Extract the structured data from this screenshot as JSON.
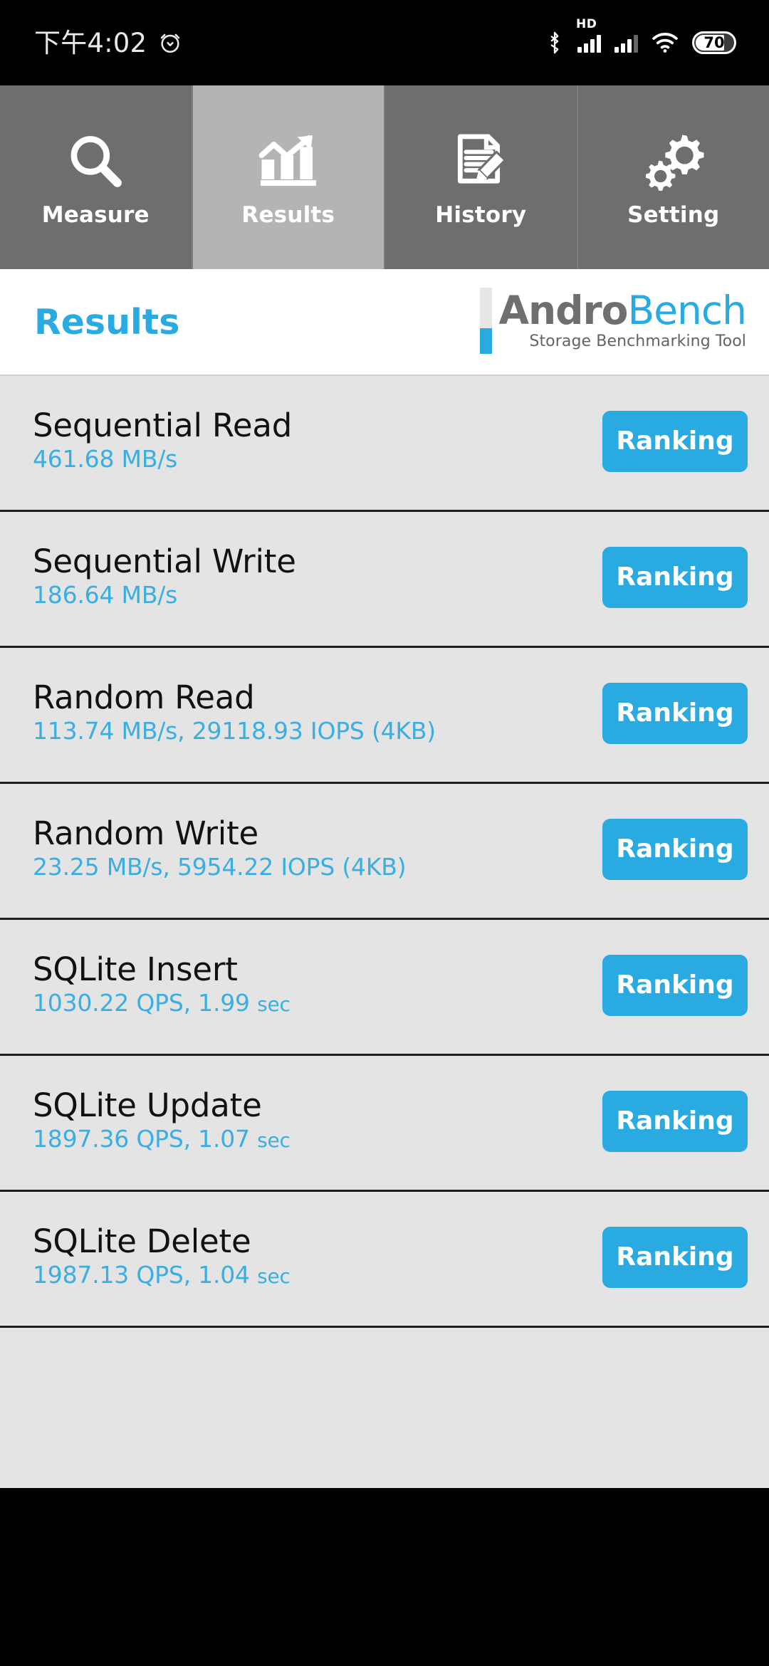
{
  "status_bar": {
    "clock": "下午4:02",
    "alarm_icon": "alarm-clock-icon",
    "bluetooth_icon": "bluetooth-icon",
    "hd_label": "HD",
    "signal_icon_1": "cellular-signal-icon",
    "signal_icon_2": "cellular-signal-icon",
    "wifi_icon": "wifi-icon",
    "battery_level": "70"
  },
  "tabs": [
    {
      "label": "Measure",
      "icon": "magnifier-icon",
      "active": false
    },
    {
      "label": "Results",
      "icon": "bar-chart-arrow-icon",
      "active": true
    },
    {
      "label": "History",
      "icon": "document-pencil-icon",
      "active": false
    },
    {
      "label": "Setting",
      "icon": "gears-icon",
      "active": false
    }
  ],
  "header": {
    "title": "Results",
    "logo_main_gray": "Andro",
    "logo_main_blue": "Bench",
    "logo_sub": "Storage Benchmarking Tool"
  },
  "colors": {
    "accent_blue": "#29abe2",
    "value_blue": "#3aaee0",
    "tab_inactive": "#6e6e6e",
    "tab_active": "#b4b4b4",
    "list_bg": "#e4e4e4",
    "divider": "#1d1d1d",
    "logo_gray": "#6f6f6f"
  },
  "results": [
    {
      "name": "Sequential Read",
      "value": "461.68 MB/s",
      "unit": "",
      "button": "Ranking"
    },
    {
      "name": "Sequential Write",
      "value": "186.64 MB/s",
      "unit": "",
      "button": "Ranking"
    },
    {
      "name": "Random Read",
      "value": "113.74 MB/s, 29118.93 IOPS (4KB)",
      "unit": "",
      "button": "Ranking"
    },
    {
      "name": "Random Write",
      "value": "23.25 MB/s, 5954.22 IOPS (4KB)",
      "unit": "",
      "button": "Ranking"
    },
    {
      "name": "SQLite Insert",
      "value": "1030.22 QPS, 1.99 ",
      "unit": "sec",
      "button": "Ranking"
    },
    {
      "name": "SQLite Update",
      "value": "1897.36 QPS, 1.07 ",
      "unit": "sec",
      "button": "Ranking"
    },
    {
      "name": "SQLite Delete",
      "value": "1987.13 QPS, 1.04 ",
      "unit": "sec",
      "button": "Ranking"
    }
  ]
}
